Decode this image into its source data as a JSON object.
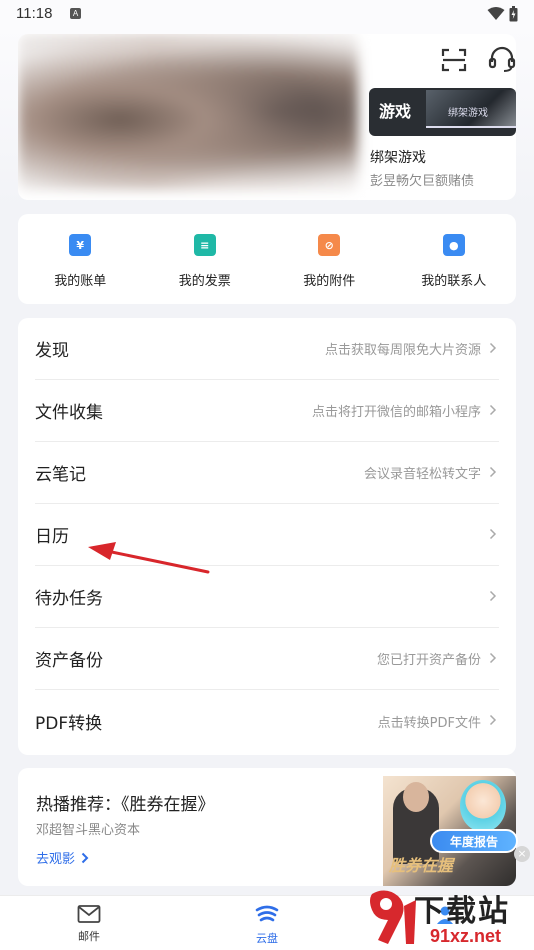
{
  "status_bar": {
    "time": "11:18",
    "indicator_letter": "A"
  },
  "banner": {
    "thumb_word": "游戏",
    "thumb_image_text": "绑架游戏",
    "title": "绑架游戏",
    "subtitle": "彭昱畅欠巨额赌债"
  },
  "quick_actions": [
    {
      "label": "我的账单",
      "icon": "bill-icon",
      "glyph": "¥",
      "color": "#3a8bf2"
    },
    {
      "label": "我的发票",
      "icon": "invoice-icon",
      "glyph": "≡",
      "color": "#1fb8a6"
    },
    {
      "label": "我的附件",
      "icon": "attachment-icon",
      "glyph": "⌀",
      "color": "#f5894a"
    },
    {
      "label": "我的联系人",
      "icon": "contact-icon",
      "glyph": "●",
      "color": "#3a8bf2"
    }
  ],
  "menu": [
    {
      "title": "发现",
      "hint": "点击获取每周限免大片资源"
    },
    {
      "title": "文件收集",
      "hint": "点击将打开微信的邮箱小程序"
    },
    {
      "title": "云笔记",
      "hint": "会议录音轻松转文字"
    },
    {
      "title": "日历",
      "hint": ""
    },
    {
      "title": "待办任务",
      "hint": ""
    },
    {
      "title": "资产备份",
      "hint": "您已打开资产备份"
    },
    {
      "title": "PDF转换",
      "hint": "点击转换PDF文件"
    }
  ],
  "promo": {
    "title": "热播推荐：《胜券在握》",
    "subtitle": "邓超智斗黑心资本",
    "link": "去观影",
    "film_title": "胜券在握",
    "report_badge": "年度报告"
  },
  "bottom_nav": [
    {
      "label": "邮件",
      "icon": "mail-icon",
      "active": false
    },
    {
      "label": "云盘",
      "icon": "cloud-disk-icon",
      "active": true
    },
    {
      "label": "",
      "icon": "person-icon",
      "active": false
    }
  ],
  "watermark": {
    "text": "下载站",
    "url": "91xz.net"
  },
  "colors": {
    "accent": "#2f6ee8",
    "annotation_arrow": "#d8262b"
  }
}
